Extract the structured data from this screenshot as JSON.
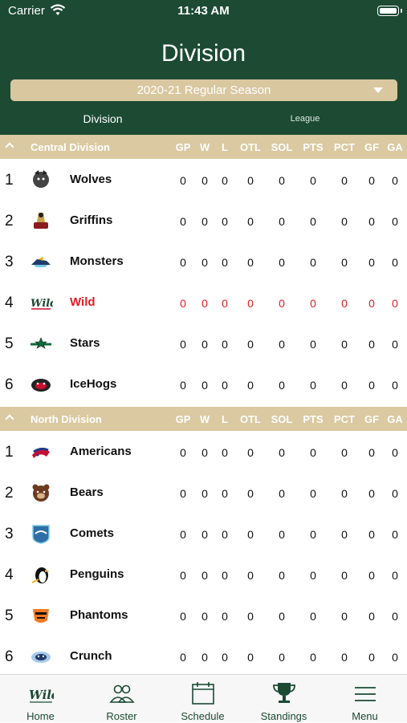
{
  "status": {
    "carrier": "Carrier",
    "time": "11:43 AM"
  },
  "header": {
    "title": "Division",
    "season": "2020-21 Regular Season",
    "tabs": [
      {
        "label": "Division"
      },
      {
        "label": "League"
      }
    ]
  },
  "columns": [
    "GP",
    "W",
    "L",
    "OTL",
    "SOL",
    "PTS",
    "PCT",
    "GF",
    "GA"
  ],
  "divisions": [
    {
      "name": "Central Division",
      "teams": [
        {
          "rank": "1",
          "name": "Wolves",
          "logo": "wolves-logo",
          "stats": [
            "0",
            "0",
            "0",
            "0",
            "0",
            "0",
            "0",
            "0",
            "0"
          ]
        },
        {
          "rank": "2",
          "name": "Griffins",
          "logo": "griffins-logo",
          "stats": [
            "0",
            "0",
            "0",
            "0",
            "0",
            "0",
            "0",
            "0",
            "0"
          ]
        },
        {
          "rank": "3",
          "name": "Monsters",
          "logo": "monsters-logo",
          "stats": [
            "0",
            "0",
            "0",
            "0",
            "0",
            "0",
            "0",
            "0",
            "0"
          ]
        },
        {
          "rank": "4",
          "name": "Wild",
          "logo": "wild-logo",
          "stats": [
            "0",
            "0",
            "0",
            "0",
            "0",
            "0",
            "0",
            "0",
            "0"
          ],
          "highlight": true
        },
        {
          "rank": "5",
          "name": "Stars",
          "logo": "stars-logo",
          "stats": [
            "0",
            "0",
            "0",
            "0",
            "0",
            "0",
            "0",
            "0",
            "0"
          ]
        },
        {
          "rank": "6",
          "name": "IceHogs",
          "logo": "icehogs-logo",
          "stats": [
            "0",
            "0",
            "0",
            "0",
            "0",
            "0",
            "0",
            "0",
            "0"
          ]
        }
      ]
    },
    {
      "name": "North Division",
      "teams": [
        {
          "rank": "1",
          "name": "Americans",
          "logo": "americans-logo",
          "stats": [
            "0",
            "0",
            "0",
            "0",
            "0",
            "0",
            "0",
            "0",
            "0"
          ]
        },
        {
          "rank": "2",
          "name": "Bears",
          "logo": "bears-logo",
          "stats": [
            "0",
            "0",
            "0",
            "0",
            "0",
            "0",
            "0",
            "0",
            "0"
          ]
        },
        {
          "rank": "3",
          "name": "Comets",
          "logo": "comets-logo",
          "stats": [
            "0",
            "0",
            "0",
            "0",
            "0",
            "0",
            "0",
            "0",
            "0"
          ]
        },
        {
          "rank": "4",
          "name": "Penguins",
          "logo": "penguins-logo",
          "stats": [
            "0",
            "0",
            "0",
            "0",
            "0",
            "0",
            "0",
            "0",
            "0"
          ]
        },
        {
          "rank": "5",
          "name": "Phantoms",
          "logo": "phantoms-logo",
          "stats": [
            "0",
            "0",
            "0",
            "0",
            "0",
            "0",
            "0",
            "0",
            "0"
          ]
        },
        {
          "rank": "6",
          "name": "Crunch",
          "logo": "crunch-logo",
          "stats": [
            "0",
            "0",
            "0",
            "0",
            "0",
            "0",
            "0",
            "0",
            "0"
          ]
        }
      ]
    }
  ],
  "tabbar": [
    {
      "label": "Home",
      "icon": "wild-logo-icon"
    },
    {
      "label": "Roster",
      "icon": "people-icon"
    },
    {
      "label": "Schedule",
      "icon": "calendar-icon"
    },
    {
      "label": "Standings",
      "icon": "trophy-icon"
    },
    {
      "label": "Menu",
      "icon": "menu-icon"
    }
  ],
  "colors": {
    "header": "#1c4a33",
    "section": "#dac9a1",
    "highlight": "#e21d24"
  }
}
